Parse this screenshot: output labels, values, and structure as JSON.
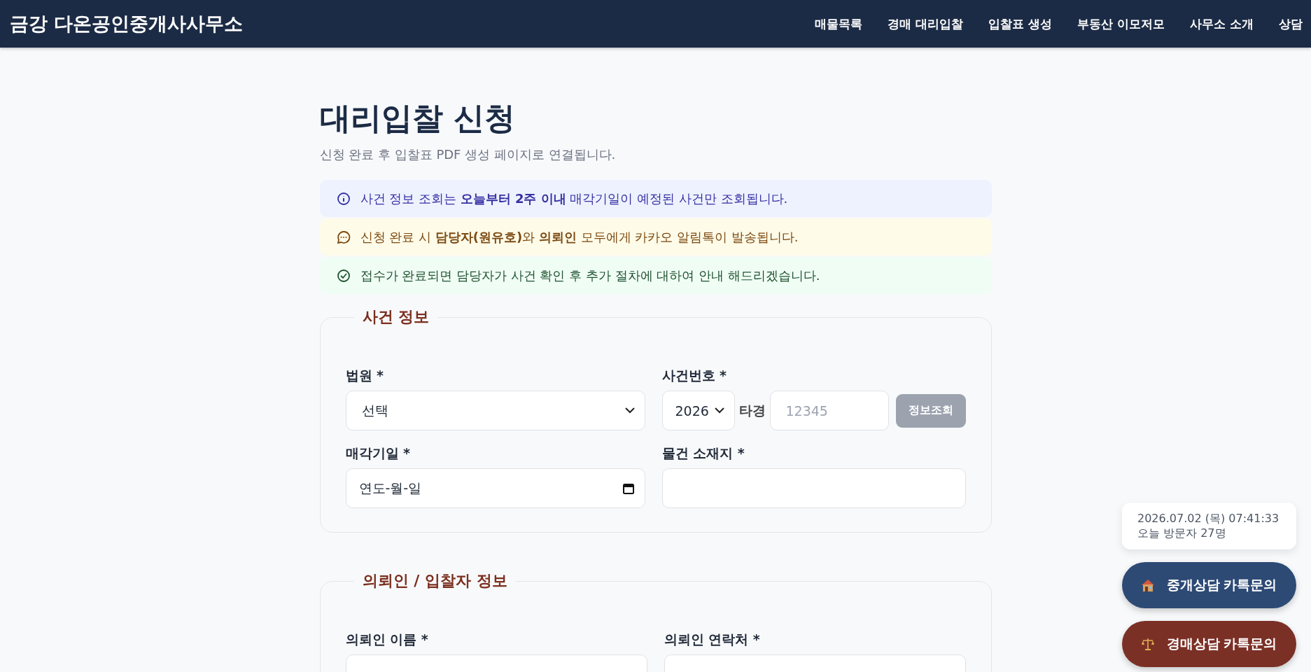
{
  "header": {
    "brand": "금강 다온공인중개사사무소",
    "nav": [
      {
        "label": "매물목록"
      },
      {
        "label": "경매 대리입찰"
      },
      {
        "label": "입찰표 생성"
      },
      {
        "label": "부동산 이모저모"
      },
      {
        "label": "사무소 소개"
      },
      {
        "label": "상담"
      }
    ]
  },
  "page": {
    "title": "대리입찰 신청",
    "subtitle": "신청 완료 후 입찰표 PDF 생성 페이지로 연결됩니다."
  },
  "notices": [
    {
      "kind": "info",
      "text": "사건 정보 조회는 **오늘부터 2주 이내** 매각기일이 예정된 사건만 조회됩니다."
    },
    {
      "kind": "chat",
      "text": "신청 완료 시 **담당자(원유호)**와 **의뢰인** 모두에게 카카오 알림톡이 발송됩니다."
    },
    {
      "kind": "check",
      "text": "접수가 완료되면 담당자가 사건 확인 후 추가 절차에 대하여 안내 해드리겠습니다."
    }
  ],
  "case_section": {
    "legend": "사건 정보",
    "court": {
      "label": "법원 *",
      "value": "선택"
    },
    "case_number": {
      "label": "사건번호 *",
      "year": "2026",
      "type": "타경",
      "placeholder": "12345",
      "button": "정보조회",
      "button_disabled": true
    },
    "sale_date": {
      "label": "매각기일 *",
      "placeholder": "연도-월-일"
    },
    "location": {
      "label": "물건 소재지 *"
    }
  },
  "client_section": {
    "legend": "의뢰인 / 입찰자 정보",
    "fields": [
      {
        "label": "의뢰인 이름 *"
      },
      {
        "label": "의뢰인 연락처 *"
      }
    ]
  },
  "widget": {
    "datetime": "2026.07.02 (목) 07:41:33",
    "visitors": "오늘 방문자 27명",
    "buttons": [
      {
        "kind": "house",
        "label": "중개상담 카톡문의"
      },
      {
        "kind": "scale",
        "label": "경매상담 카톡문의"
      }
    ]
  }
}
